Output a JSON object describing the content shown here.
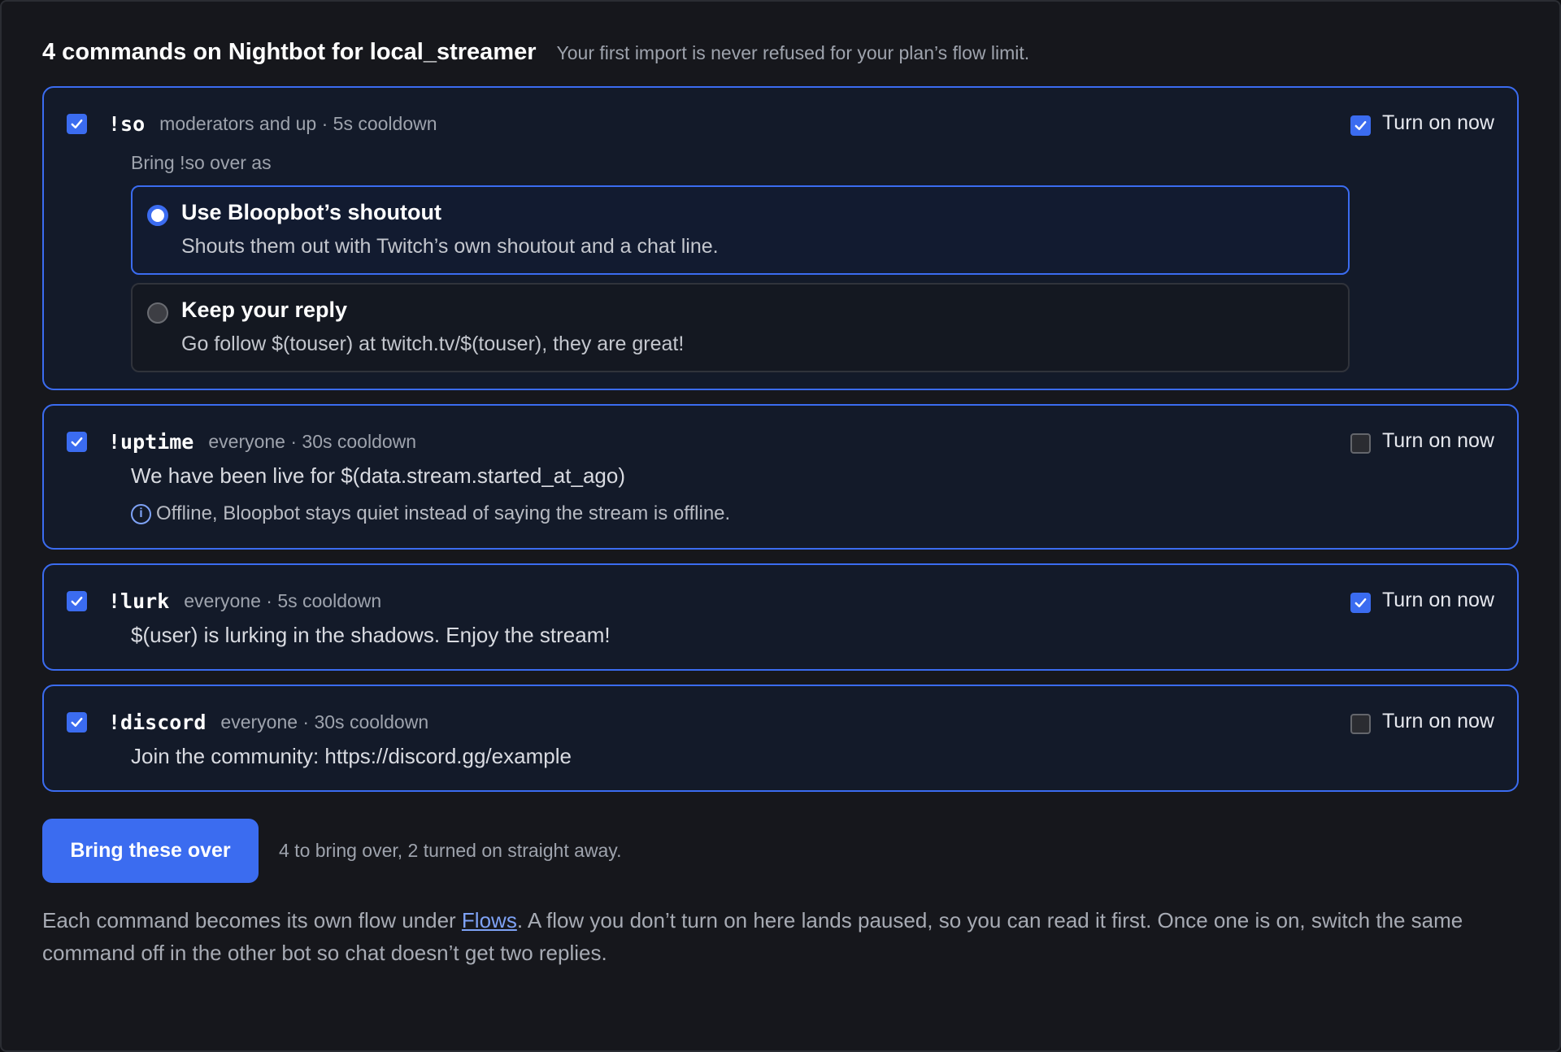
{
  "header": {
    "title": "4 commands on Nightbot for local_streamer",
    "subtitle": "Your first import is never refused for your plan’s flow limit."
  },
  "commands": [
    {
      "name": "!so",
      "meta": "moderators and up · 5s cooldown",
      "selected": true,
      "turn_on_label": "Turn on now",
      "turn_on": true,
      "bring_label": "Bring !so over as",
      "options": [
        {
          "title": "Use Bloopbot’s shoutout",
          "description": "Shouts them out with Twitch’s own shoutout and a chat line.",
          "selected": true
        },
        {
          "title": "Keep your reply",
          "description": "Go follow $(touser) at twitch.tv/$(touser), they are great!",
          "selected": false
        }
      ]
    },
    {
      "name": "!uptime",
      "meta": "everyone · 30s cooldown",
      "selected": true,
      "turn_on_label": "Turn on now",
      "turn_on": false,
      "reply": "We have been live for $(data.stream.started_at_ago)",
      "note": "Offline, Bloopbot stays quiet instead of saying the stream is offline."
    },
    {
      "name": "!lurk",
      "meta": "everyone · 5s cooldown",
      "selected": true,
      "turn_on_label": "Turn on now",
      "turn_on": true,
      "reply": "$(user) is lurking in the shadows. Enjoy the stream!"
    },
    {
      "name": "!discord",
      "meta": "everyone · 30s cooldown",
      "selected": true,
      "turn_on_label": "Turn on now",
      "turn_on": false,
      "reply": "Join the community: https://discord.gg/example"
    }
  ],
  "footer": {
    "button_label": "Bring these over",
    "summary": "4 to bring over, 2 turned on straight away.",
    "explain_before": "Each command becomes its own flow under ",
    "explain_link": "Flows",
    "explain_after": ". A flow you don’t turn on here lands paused, so you can read it first. Once one is on, switch the same command off in the other bot so chat doesn’t get two replies."
  },
  "colors": {
    "accent": "#3b6cf0",
    "panel": "#16171c",
    "card": "#131a29"
  }
}
